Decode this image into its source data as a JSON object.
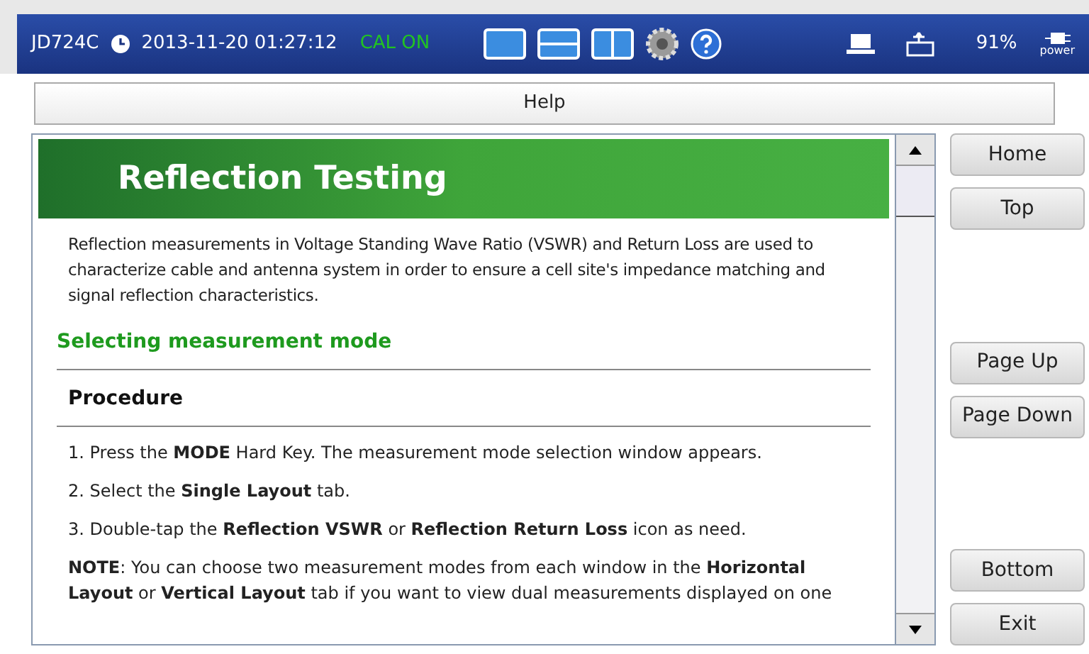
{
  "status_bar": {
    "model": "JD724C",
    "datetime": "2013-11-20 01:27:12",
    "cal": "CAL ON",
    "battery": "91%",
    "power_label": "power"
  },
  "title_bar": {
    "title": "Help"
  },
  "article": {
    "title": "Reflection Testing",
    "intro": "Reflection measurements in Voltage Standing Wave Ratio (VSWR) and Return Loss are used to characterize cable and antenna system in order to ensure a cell site's impedance matching and signal reflection characteristics.",
    "section": "Selecting measurement mode",
    "subsection": "Procedure",
    "steps": [
      "1. Press the **MODE** Hard Key. The measurement mode selection window appears.",
      "2. Select the **Single Layout** tab.",
      "3. Double-tap the **Reflection VSWR** or **Reflection Return Loss** icon as need.",
      "**NOTE**: You can choose two measurement modes from each window in the **Horizontal Layout** or **Vertical Layout** tab if you want to view dual measurements displayed on one"
    ]
  },
  "button_groups": [
    [
      "Home",
      "Top"
    ],
    [
      "Page Up",
      "Page Down"
    ],
    [
      "Bottom",
      "Exit"
    ]
  ]
}
